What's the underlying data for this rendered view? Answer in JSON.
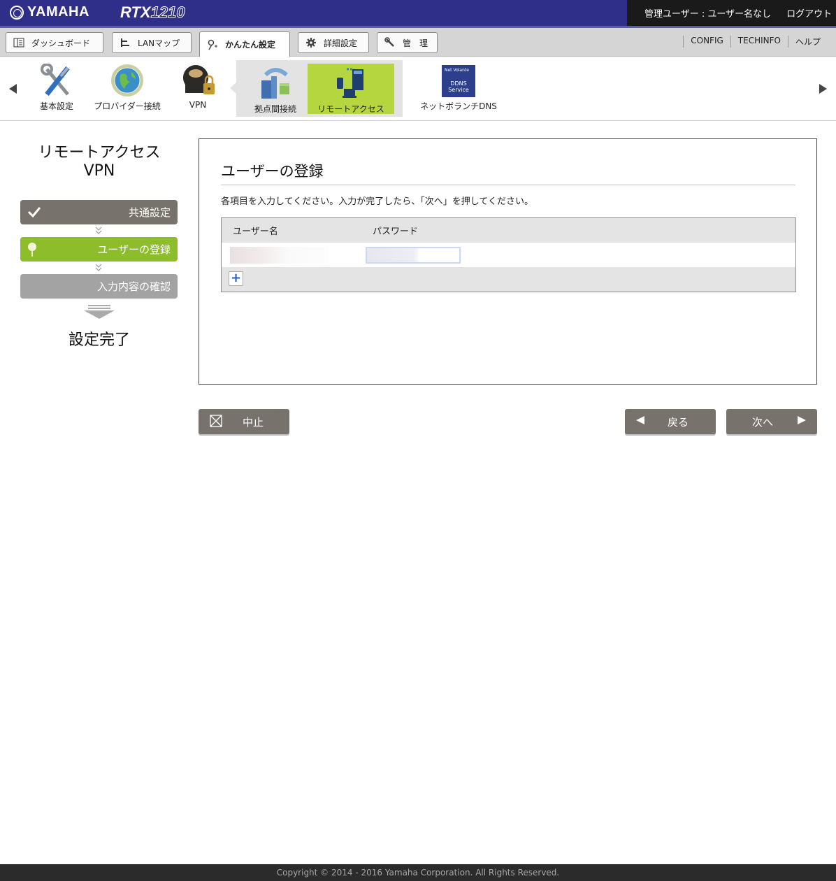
{
  "header": {
    "brand": "YAMAHA",
    "model_prefix": "RTX",
    "model_number": "1210",
    "user_label": "管理ユーザー : ユーザー名なし",
    "logout": "ログアウト"
  },
  "tabs": [
    {
      "label": "ダッシュボード",
      "icon": "dashboard-icon"
    },
    {
      "label": "LANマップ",
      "icon": "lan-map-icon"
    },
    {
      "label": "かんたん設定",
      "icon": "wizard-icon",
      "active": true
    },
    {
      "label": "詳細設定",
      "icon": "gear-icon"
    },
    {
      "label": "管　理",
      "icon": "wrench-icon"
    }
  ],
  "top_links": [
    "CONFIG",
    "TECHINFO",
    "ヘルプ"
  ],
  "menu_icons": [
    {
      "label": "基本設定",
      "icon": "tools-icon"
    },
    {
      "label": "プロバイダー接続",
      "icon": "globe-icon"
    },
    {
      "label": "VPN",
      "icon": "vpn-lock-icon"
    },
    {
      "label": "拠点間接続",
      "icon": "site-to-site-icon"
    },
    {
      "label": "リモートアクセス",
      "icon": "remote-access-icon",
      "selected": true
    },
    {
      "label": "ネットボランチDNS",
      "icon": "ddns-service-icon",
      "badge_lines": [
        "Net Volante",
        "DDNS",
        "Service"
      ]
    }
  ],
  "sidebar": {
    "title_line1": "リモートアクセス",
    "title_line2": "VPN",
    "steps": [
      {
        "label": "共通設定",
        "state": "done"
      },
      {
        "label": "ユーザーの登録",
        "state": "current"
      },
      {
        "label": "入力内容の確認",
        "state": "todo"
      }
    ],
    "final_label": "設定完了"
  },
  "panel": {
    "title": "ユーザーの登録",
    "description": "各項目を入力してください。入力が完了したら、「次へ」を押してください。",
    "columns": [
      "ユーザー名",
      "パスワード"
    ],
    "add_row_symbol": "+"
  },
  "buttons": {
    "cancel": "中止",
    "back": "戻る",
    "next": "次へ"
  },
  "footer": {
    "copyright": "Copyright © 2014 - 2016 Yamaha Corporation. All Rights Reserved."
  },
  "colors": {
    "header_bg": "#2f2f8a",
    "accent_green": "#8ebd2c",
    "step_done": "#77736c",
    "step_todo": "#a3a3a3"
  }
}
